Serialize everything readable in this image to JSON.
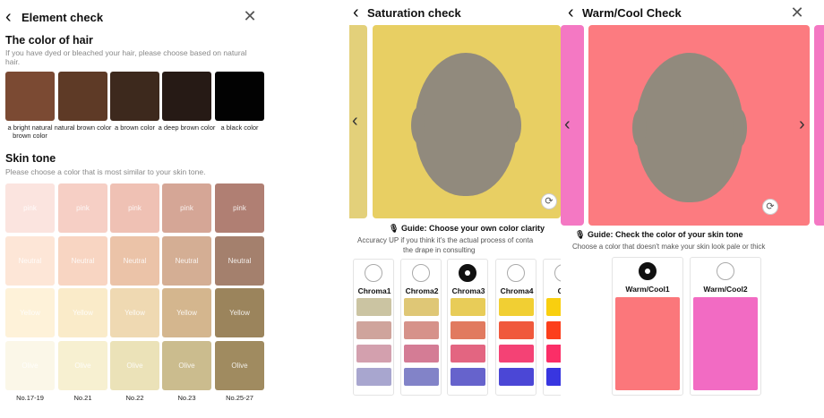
{
  "panel1": {
    "title": "Element check",
    "hair": {
      "title": "The color of hair",
      "subtitle": "If you have dyed or bleached your hair, please choose based on natural hair.",
      "options": [
        {
          "label": "a bright natural brown color",
          "color": "#7b4a33"
        },
        {
          "label": "natural brown color",
          "color": "#5e3a26"
        },
        {
          "label": "a brown color",
          "color": "#3d291d"
        },
        {
          "label": "a deep brown color",
          "color": "#261a15"
        },
        {
          "label": "a black color",
          "color": "#020202"
        }
      ]
    },
    "skin": {
      "title": "Skin tone",
      "subtitle": "Please choose a color that is most similar to your skin tone.",
      "rows": [
        {
          "colors": [
            "#fbe4df",
            "#f6cfc5",
            "#efc1b4",
            "#d5a696",
            "#b07f73"
          ],
          "label": "pink"
        },
        {
          "colors": [
            "#fde6d7",
            "#f8d5c2",
            "#ebc3a8",
            "#d4ae94",
            "#a4806d"
          ],
          "label": "Neutral"
        },
        {
          "colors": [
            "#fef2d9",
            "#faebc9",
            "#efd9b2",
            "#d4b68e",
            "#9b845c"
          ],
          "label": "Yellow"
        },
        {
          "colors": [
            "#fbf7e8",
            "#f7f0d1",
            "#ebe2b8",
            "#cbbc8e",
            "#a08b60"
          ],
          "label": "Olive"
        }
      ],
      "numbers": [
        "No.17-19",
        "No.21",
        "No.22",
        "No.23",
        "No.25-27"
      ]
    }
  },
  "panel2": {
    "title": "Saturation check",
    "guide": "Guide: Choose your own color clarity",
    "guide_sub_1": "Accuracy UP if you think it's the actual process of conta",
    "guide_sub_2": "the drape in consulting",
    "photo_color": "#e8cf63",
    "chromas": [
      {
        "label": "Chroma1",
        "selected": false,
        "swatches": [
          "#cbc4a2",
          "#cfa49c",
          "#d3a0ae",
          "#a8a6cf"
        ]
      },
      {
        "label": "Chroma2",
        "selected": false,
        "swatches": [
          "#dfc776",
          "#d6928a",
          "#d47c95",
          "#8283c8"
        ]
      },
      {
        "label": "Chroma3",
        "selected": true,
        "swatches": [
          "#e8cc58",
          "#e17a5f",
          "#e36581",
          "#6663cc"
        ]
      },
      {
        "label": "Chroma4",
        "selected": false,
        "swatches": [
          "#f1cf33",
          "#f0593c",
          "#f44275",
          "#4b47d6"
        ]
      },
      {
        "label": "Chr",
        "selected": false,
        "swatches": [
          "#f9cf0f",
          "#fc3f1c",
          "#fb2e67",
          "#3836e0"
        ]
      }
    ]
  },
  "panel3": {
    "title": "Warm/Cool Check",
    "guide": "Guide: Check the color of your skin tone",
    "guide_sub": "Choose a color that doesn't make your skin look pale or thick",
    "photo_color": "#fc7b80",
    "options": [
      {
        "label": "Warm/Cool1",
        "selected": true,
        "color": "#fb777b"
      },
      {
        "label": "Warm/Cool2",
        "selected": false,
        "color": "#f26bc3"
      }
    ]
  }
}
